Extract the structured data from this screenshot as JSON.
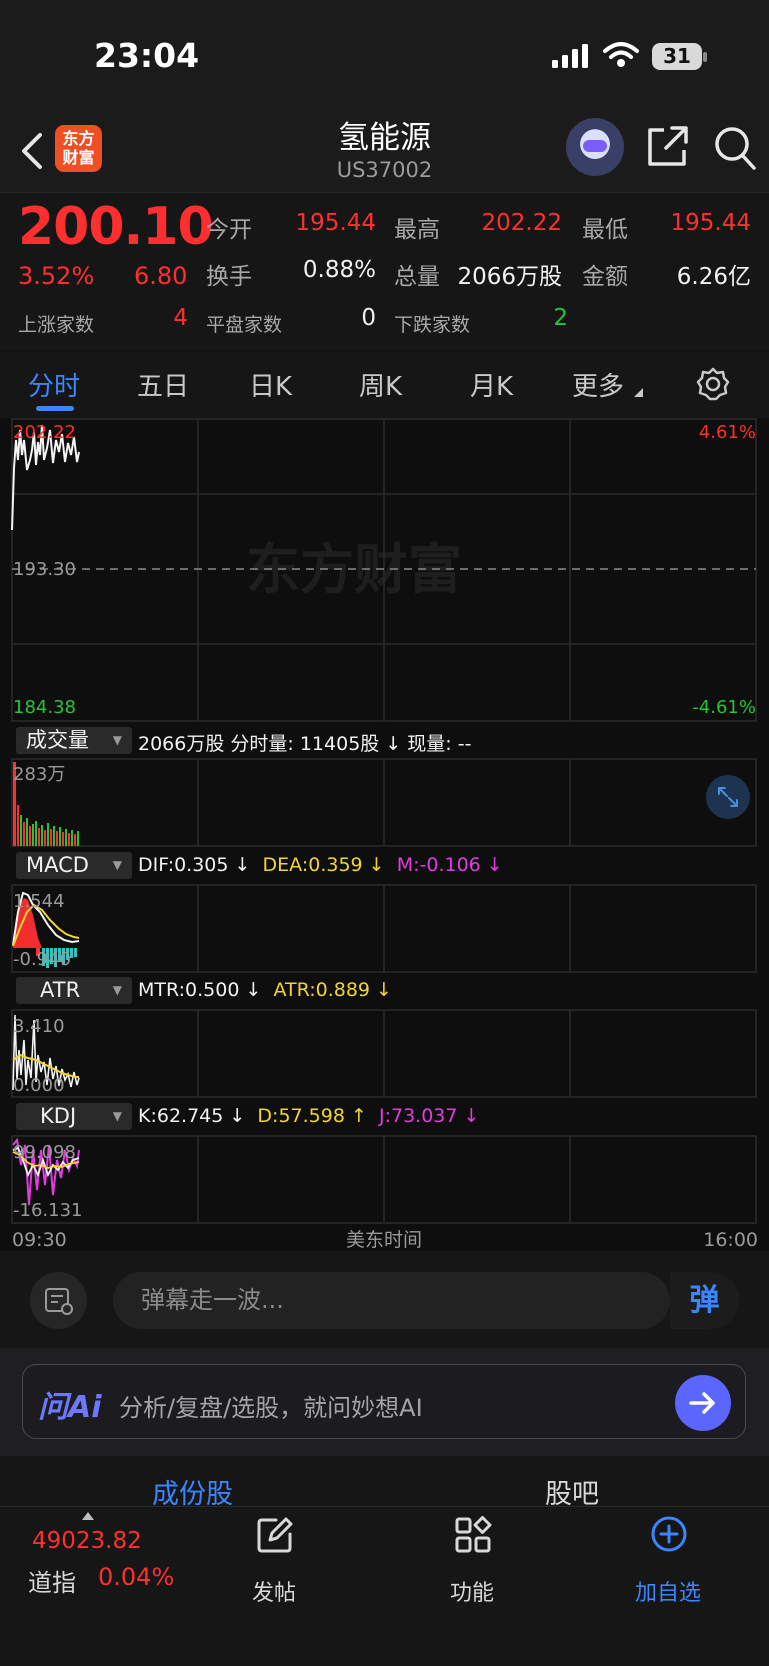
{
  "status_bar": {
    "time": "23:04",
    "battery": "31"
  },
  "header": {
    "logo_text": "东方\n财富",
    "title": "氢能源",
    "code": "US37002"
  },
  "quote": {
    "price": "200.10",
    "change_pct": "3.52%",
    "change": "6.80",
    "rows": [
      {
        "l1": "今开",
        "v1": "195.44",
        "l2": "最高",
        "v2": "202.22",
        "l3": "最低",
        "v3": "195.44"
      },
      {
        "l1": "换手",
        "v1": "0.88%",
        "l2": "总量",
        "v2": "2066万股",
        "l3": "金额",
        "v3": "6.26亿"
      }
    ],
    "breadth": {
      "up_label": "上涨家数",
      "up": "4",
      "flat_label": "平盘家数",
      "flat": "0",
      "down_label": "下跌家数",
      "down": "2"
    }
  },
  "tabs": [
    "分时",
    "五日",
    "日K",
    "周K",
    "月K",
    "更多"
  ],
  "chart": {
    "watermark": "东方财富",
    "price_high": "202.22",
    "price_mid": "193.30",
    "price_low": "184.38",
    "pct_high": "4.61%",
    "pct_low": "-4.61%",
    "time_start": "09:30",
    "time_label": "美东时间",
    "time_end": "16:00",
    "volume": {
      "chip": "成交量",
      "summary": "2066万股 分时量: 11405股 ↓ 现量: --",
      "max_label": "283万"
    },
    "macd": {
      "chip": "MACD",
      "dif": "DIF:0.305 ↓",
      "dea": "DEA:0.359 ↓",
      "m": "M:-0.106 ↓",
      "top": "1.544",
      "bottom": "-0.940"
    },
    "atr": {
      "chip": "ATR",
      "mtr": "MTR:0.500 ↓",
      "atr": "ATR:0.889 ↓",
      "top": "3.410",
      "bottom": "0.000"
    },
    "kdj": {
      "chip": "KDJ",
      "k": "K:62.745 ↓",
      "d": "D:57.598 ↑",
      "j": "J:73.037 ↓",
      "top": "99.098",
      "bottom": "-16.131"
    }
  },
  "danmaku": {
    "placeholder": "弹幕走一波...",
    "button": "弹"
  },
  "ai": {
    "logo": "问Ai",
    "text": "分析/复盘/选股，就问妙想AI"
  },
  "sub_tabs": [
    "成份股",
    "股吧"
  ],
  "bottom_nav": {
    "index_value": "49023.82",
    "index_name": "道指",
    "index_pct": "0.04%",
    "items": [
      "发帖",
      "功能",
      "加自选"
    ]
  },
  "colors": {
    "up": "#ff2f2f",
    "down": "#25c537",
    "accent": "#3a86ff"
  }
}
